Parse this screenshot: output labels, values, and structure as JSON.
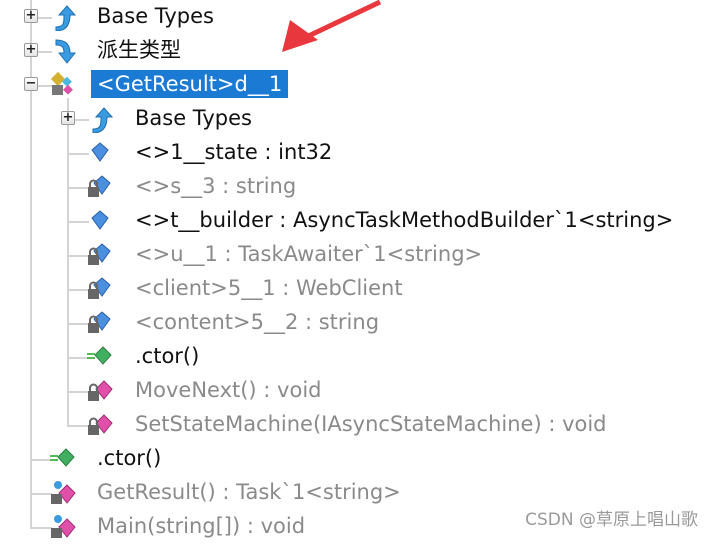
{
  "tree": [
    {
      "label": "Base Types",
      "level": 0,
      "expander": "plus",
      "icon": "base-types-icon",
      "style": "normal"
    },
    {
      "label": "派生类型",
      "level": 0,
      "expander": "plus",
      "icon": "derived-types-icon",
      "style": "normal"
    },
    {
      "label": "<GetResult>d__1",
      "level": 0,
      "expander": "minus",
      "icon": "nested-class-icon",
      "style": "selected"
    },
    {
      "label": "Base Types",
      "level": 1,
      "expander": "plus",
      "icon": "base-types-icon",
      "style": "normal"
    },
    {
      "label": "<>1__state : int32",
      "level": 1,
      "icon": "field-icon",
      "style": "normal"
    },
    {
      "label": "<>s__3 : string",
      "level": 1,
      "icon": "private-field-icon",
      "style": "gray"
    },
    {
      "label": "<>t__builder : AsyncTaskMethodBuilder`1<string>",
      "level": 1,
      "icon": "field-icon",
      "style": "normal"
    },
    {
      "label": "<>u__1 : TaskAwaiter`1<string>",
      "level": 1,
      "icon": "private-field-icon",
      "style": "gray"
    },
    {
      "label": "<client>5__1 : WebClient",
      "level": 1,
      "icon": "private-field-icon",
      "style": "gray"
    },
    {
      "label": "<content>5__2 : string",
      "level": 1,
      "icon": "private-field-icon",
      "style": "gray"
    },
    {
      "label": ".ctor()",
      "level": 1,
      "icon": "constructor-icon",
      "style": "normal"
    },
    {
      "label": "MoveNext() : void",
      "level": 1,
      "icon": "private-method-icon",
      "style": "gray"
    },
    {
      "label": "SetStateMachine(IAsyncStateMachine) : void",
      "level": 1,
      "icon": "private-method-icon",
      "style": "gray"
    },
    {
      "label": ".ctor()",
      "level": 0,
      "icon": "constructor-icon",
      "style": "normal"
    },
    {
      "label": "GetResult() : Task`1<string>",
      "level": 0,
      "icon": "private-static-method-icon",
      "style": "gray"
    },
    {
      "label": "Main(string[]) : void",
      "level": 0,
      "icon": "private-static-method-icon",
      "style": "gray"
    }
  ],
  "annotation_arrow_color": "#e8383d",
  "selection_color": "#1a7ad4",
  "watermark": "CSDN @草原上唱山歌"
}
